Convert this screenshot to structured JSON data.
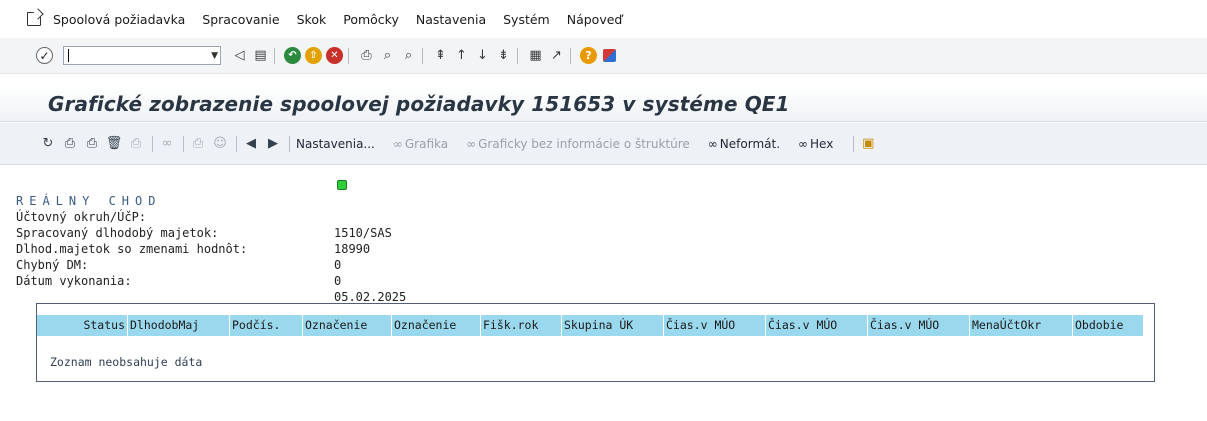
{
  "menu": {
    "items": [
      "Spoolová požiadavka",
      "Spracovanie",
      "Skok",
      "Pomôcky",
      "Nastavenia",
      "Systém",
      "Nápoveď"
    ]
  },
  "std_toolbar": {
    "command_value": "",
    "icons": [
      "enter-icon",
      "back-icon",
      "save-icon",
      "back-green-icon",
      "exit-icon",
      "cancel-icon",
      "print-icon",
      "find-icon",
      "find-next-icon",
      "first-page-icon",
      "prev-page-icon",
      "next-page-icon",
      "last-page-icon",
      "create-session-icon",
      "shortcut-icon",
      "help-icon",
      "layout-icon"
    ]
  },
  "title": "Grafické zobrazenie spoolovej požiadavky 151653 v systéme QE1",
  "app_toolbar": {
    "nastavenia": "Nastavenia...",
    "grafika": "Grafika",
    "graficky": "Graficky bez informácie o štruktúre",
    "neformat": "Neformát.",
    "hex": "Hex"
  },
  "report": {
    "heading": "REÁLNY CHOD",
    "rows": [
      {
        "label": "Účtovný okruh/ÚčP:",
        "value": "1510/SAS"
      },
      {
        "label": "Spracovaný dlhodobý majetok:",
        "value": "18990"
      },
      {
        "label": "Dlhod.majetok so zmenami hodnôt:",
        "value": "0"
      },
      {
        "label": "Chybný DM:",
        "value": "0"
      },
      {
        "label": "Dátum vykonania:",
        "value": "05.02.2025"
      }
    ],
    "status_color": "#2fcf3a"
  },
  "grid": {
    "columns": [
      "Status",
      "DlhodobMaj",
      "Podčís.",
      "Označenie",
      "Označenie",
      "Fišk.rok",
      "Skupina ÚK",
      "Čias.v MÚO",
      "Čias.v MÚO",
      "Čias.v MÚO",
      "MenaÚčtOkr",
      "Obdobie"
    ],
    "empty_text": "Zoznam neobsahuje dáta"
  },
  "colors": {
    "header_bg": "#9ad8ee",
    "title_text": "#2a3644"
  }
}
